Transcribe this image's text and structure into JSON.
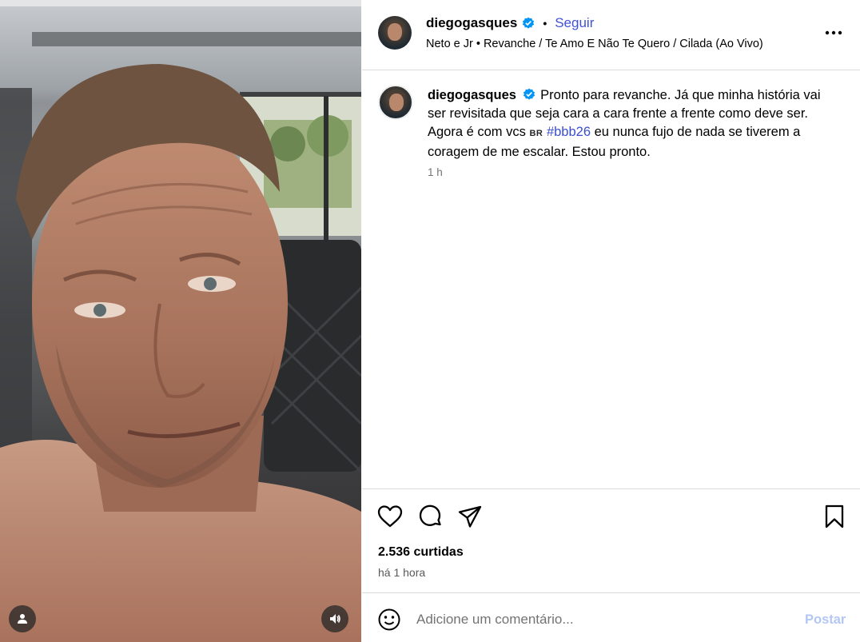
{
  "post": {
    "username": "diegogasques",
    "follow_label": "Seguir",
    "separator": "•",
    "audio": "Neto e Jr • Revanche / Te Amo E Não Te Quero / Cilada (Ao Vivo)",
    "more_icon": "more-horizontal-icon",
    "verified_icon": "verified-badge-icon",
    "caption": {
      "username": "diegogasques",
      "text_before": "Pronto para revanche. Já que minha história vai ser revisitada que seja cara a cara frente a frente como deve ser. Agora é com vcs ",
      "flag": "BR",
      "hashtag": "#bbb26",
      "text_after": " eu nunca fujo de nada se tiverem a coragem de me escalar. Estou pronto.",
      "time": "1 h"
    },
    "likes": "2.536 curtidas",
    "posted": "há 1 hora",
    "actions": [
      "heart-icon",
      "comment-icon",
      "share-icon",
      "bookmark-icon"
    ]
  },
  "comment_box": {
    "placeholder": "Adicione um comentário...",
    "post_label": "Postar",
    "emoji_icon": "emoji-icon"
  },
  "media": {
    "tag_icon": "user-tag-icon",
    "sound_icon": "speaker-icon"
  },
  "colors": {
    "link_blue": "#3f51d8",
    "post_disabled": "#b3c6f5",
    "verified": "#0095f6",
    "muted": "#737373",
    "border": "#dbdbdb"
  }
}
